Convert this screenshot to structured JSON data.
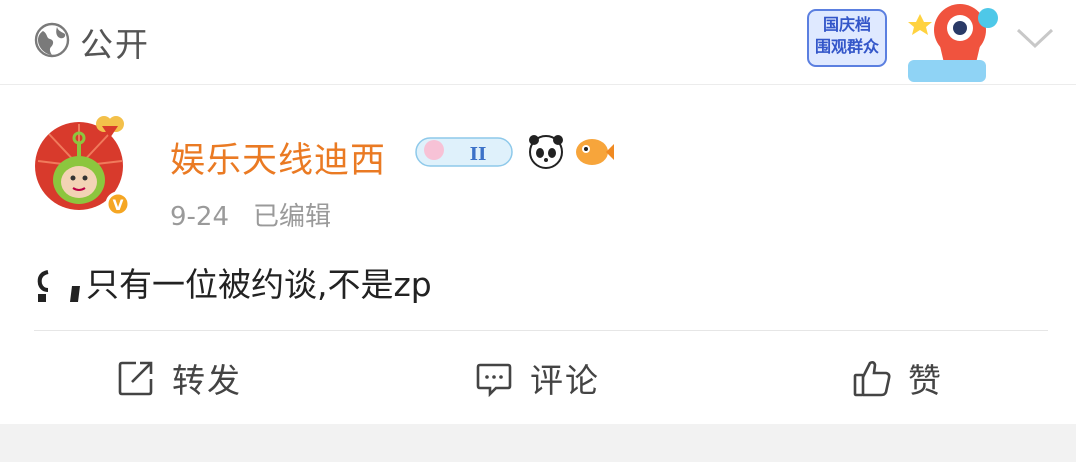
{
  "header": {
    "visibility_label": "公开",
    "visibility_icon": "globe-icon",
    "event_badge_text": [
      "国庆档",
      "围观群众"
    ],
    "collapse_icon": "chevron-down-icon"
  },
  "post": {
    "author": {
      "name": "娱乐天线迪西",
      "verified_icon": "verified-v-icon"
    },
    "author_badges": [
      "badge-icon",
      "panda-icon",
      "fish-icon"
    ],
    "date": "9-24",
    "edited": "已编辑",
    "text": "只有一位被约谈,不是zp"
  },
  "actions": {
    "repost": {
      "label": "转发",
      "icon": "share-icon"
    },
    "comment": {
      "label": "评论",
      "icon": "comment-icon"
    },
    "like": {
      "label": "赞",
      "icon": "thumbs-up-icon"
    }
  },
  "colors": {
    "username": "#ea7a23",
    "muted": "#9a9a9a",
    "verified": "#f5a623"
  }
}
